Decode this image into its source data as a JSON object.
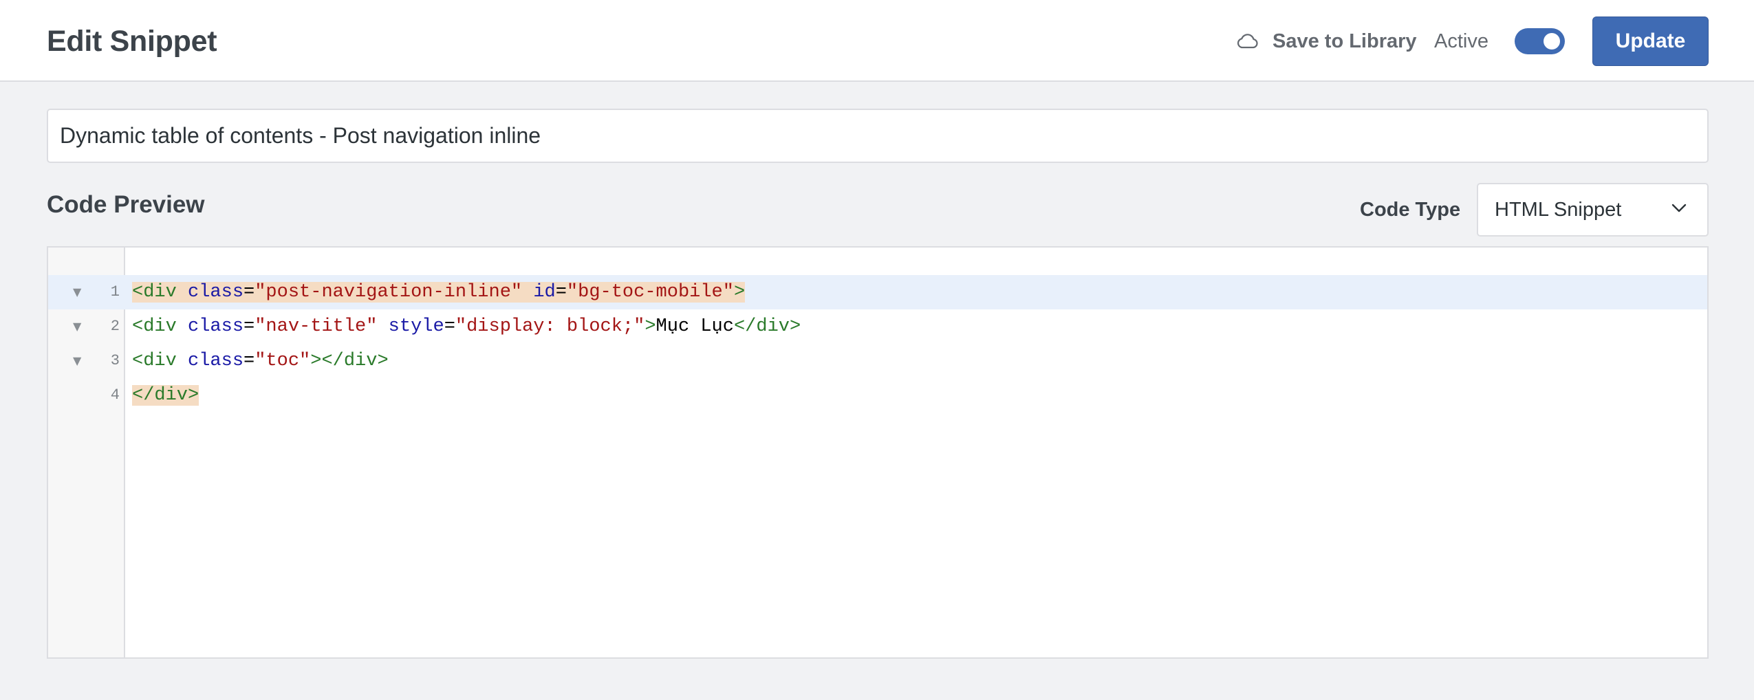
{
  "header": {
    "title": "Edit Snippet",
    "save_to_library": "Save to Library",
    "active_label": "Active",
    "active_toggle_on": true,
    "update_label": "Update"
  },
  "snippet": {
    "title": "Dynamic table of contents - Post navigation inline"
  },
  "code_preview": {
    "heading": "Code Preview",
    "code_type_label": "Code Type",
    "code_type_value": "HTML Snippet"
  },
  "editor": {
    "line_numbers": [
      "1",
      "2",
      "3",
      "4"
    ],
    "line1": {
      "open": "<div",
      "attr1": "class",
      "eq1": "=",
      "val1": "\"post-navigation-inline\"",
      "attr2": "id",
      "eq2": "=",
      "val2": "\"bg-toc-mobile\"",
      "close": ">"
    },
    "line2": {
      "open": "<div",
      "attr1": "class",
      "eq1": "=",
      "val1": "\"nav-title\"",
      "attr2": "style",
      "eq2": "=",
      "val2": "\"display: block;\"",
      "close": ">",
      "text": "Mục Lục",
      "end_tag": "</div>"
    },
    "line3": {
      "open": "<div",
      "attr1": "class",
      "eq1": "=",
      "val1": "\"toc\"",
      "close": ">",
      "end_tag": "</div>"
    },
    "line4": {
      "end_tag": "</div>"
    }
  },
  "colors": {
    "accent": "#3f6bb4",
    "tag": "#2a7a2a",
    "attribute": "#1a1aa6",
    "string": "#a31515",
    "active_line": "#e8f0fb",
    "bracket_match": "#f5dcc3"
  },
  "icons": {
    "save_to_library": "cloud-icon",
    "code_type_dropdown": "chevron-down-icon",
    "fold_marker": "fold-arrow-icon"
  }
}
